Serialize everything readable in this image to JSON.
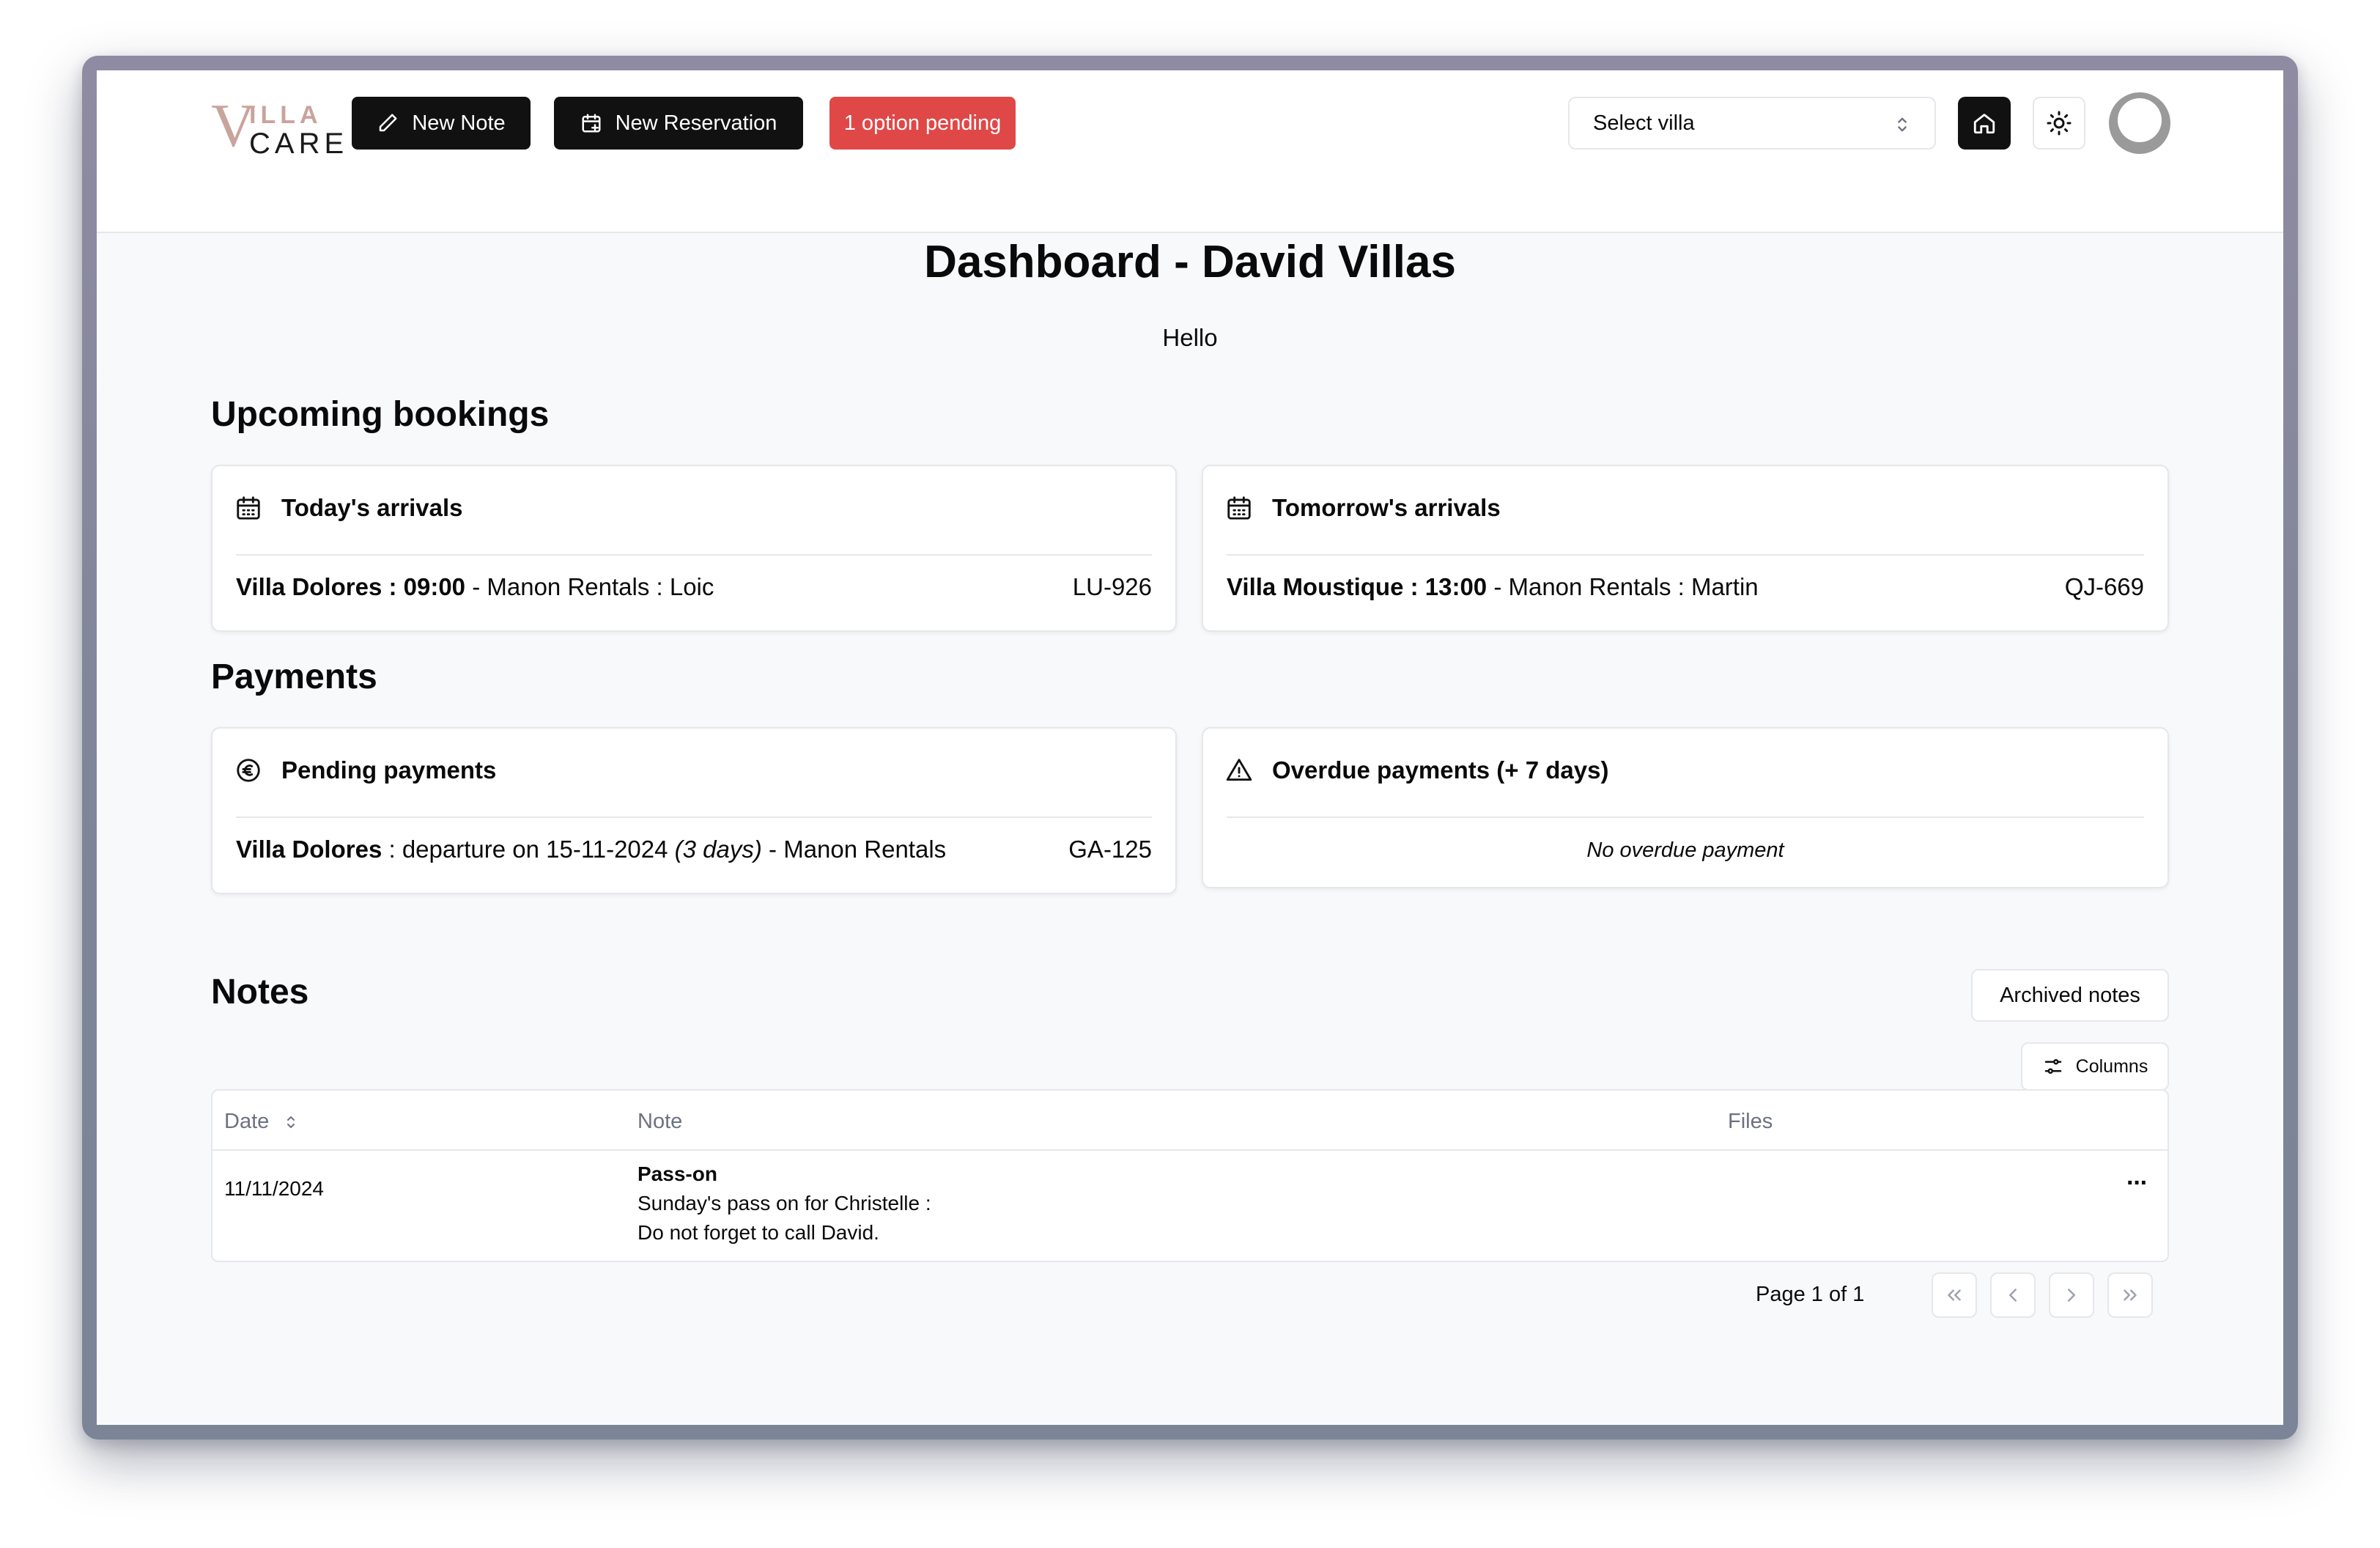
{
  "header": {
    "logo": {
      "v": "V",
      "illa": "ILLA",
      "care": "CARE"
    },
    "new_note_label": "New Note",
    "new_reservation_label": "New Reservation",
    "option_pending_label": "1 option pending",
    "select_villa_placeholder": "Select villa"
  },
  "page": {
    "title": "Dashboard - David Villas",
    "greeting": "Hello"
  },
  "upcoming_bookings": {
    "section_title": "Upcoming bookings",
    "today": {
      "title": "Today's arrivals",
      "villa_time": "Villa Dolores : 09:00",
      "details": " - Manon Rentals : Loic",
      "code": "LU-926"
    },
    "tomorrow": {
      "title": "Tomorrow's arrivals",
      "villa_time": "Villa Moustique : 13:00",
      "details": " - Manon Rentals : Martin",
      "code": "QJ-669"
    }
  },
  "payments": {
    "section_title": "Payments",
    "pending": {
      "title": "Pending payments",
      "villa": "Villa Dolores",
      "details": " : departure on 15-11-2024 ",
      "days": "(3 days)",
      "agency": " - Manon Rentals",
      "code": "GA-125"
    },
    "overdue": {
      "title": "Overdue payments (+ 7 days)",
      "empty_text": "No overdue payment"
    }
  },
  "notes": {
    "section_title": "Notes",
    "archived_label": "Archived notes",
    "columns_label": "Columns",
    "headers": {
      "date": "Date",
      "note": "Note",
      "files": "Files"
    },
    "rows": [
      {
        "date": "11/11/2024",
        "title": "Pass-on",
        "line1": "Sunday's pass on for Christelle :",
        "line2": "Do not forget to call David.",
        "actions": "···"
      }
    ],
    "pagination": {
      "label": "Page 1 of 1"
    }
  },
  "colors": {
    "primary_dark": "#111111",
    "alert": "#e04848",
    "logo_accent": "#c9a49c",
    "page_bg": "#f8f9fb"
  }
}
